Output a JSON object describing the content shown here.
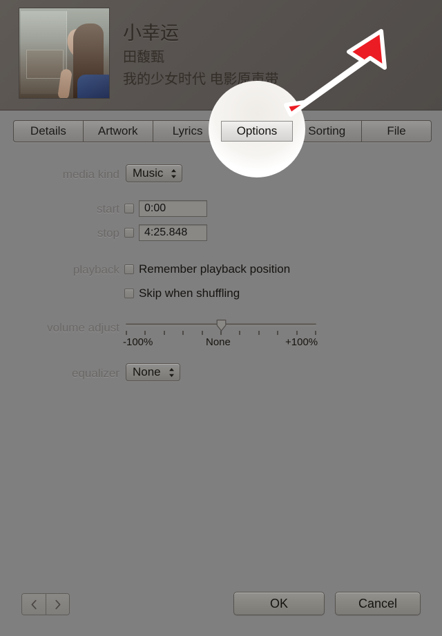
{
  "header": {
    "song_title": "小幸运",
    "artist": "田馥甄",
    "album": "我的少女时代 电影原声带",
    "artwork_name": "album-artwork"
  },
  "tabs": [
    {
      "label": "Details",
      "selected": false
    },
    {
      "label": "Artwork",
      "selected": false
    },
    {
      "label": "Lyrics",
      "selected": false
    },
    {
      "label": "Options",
      "selected": true
    },
    {
      "label": "Sorting",
      "selected": false
    },
    {
      "label": "File",
      "selected": false
    }
  ],
  "form": {
    "media_kind": {
      "label": "media kind",
      "value": "Music"
    },
    "start": {
      "label": "start",
      "checked": false,
      "value": "0:00"
    },
    "stop": {
      "label": "stop",
      "checked": false,
      "value": "4:25.848"
    },
    "playback": {
      "label": "playback",
      "remember_label": "Remember playback position",
      "remember_checked": false,
      "skip_label": "Skip when shuffling",
      "skip_checked": false
    },
    "volume_adjust": {
      "label": "volume adjust",
      "min_label": "-100%",
      "center_label": "None",
      "max_label": "+100%",
      "value": 0,
      "tick_count": 11
    },
    "equalizer": {
      "label": "equalizer",
      "value": "None"
    }
  },
  "footer": {
    "prev_label": "‹",
    "next_label": "›",
    "ok_label": "OK",
    "cancel_label": "Cancel"
  },
  "annotation": {
    "highlight_target": "Options",
    "arrow_color": "#ec1c24",
    "arrow_outline": "#ffffff"
  },
  "colors": {
    "panel_bg": "#807f7f",
    "header_bg": "#58534f",
    "selected_tab_bg": "#c3c1bf",
    "label_text": "#6a6866",
    "value_text": "#141310"
  }
}
